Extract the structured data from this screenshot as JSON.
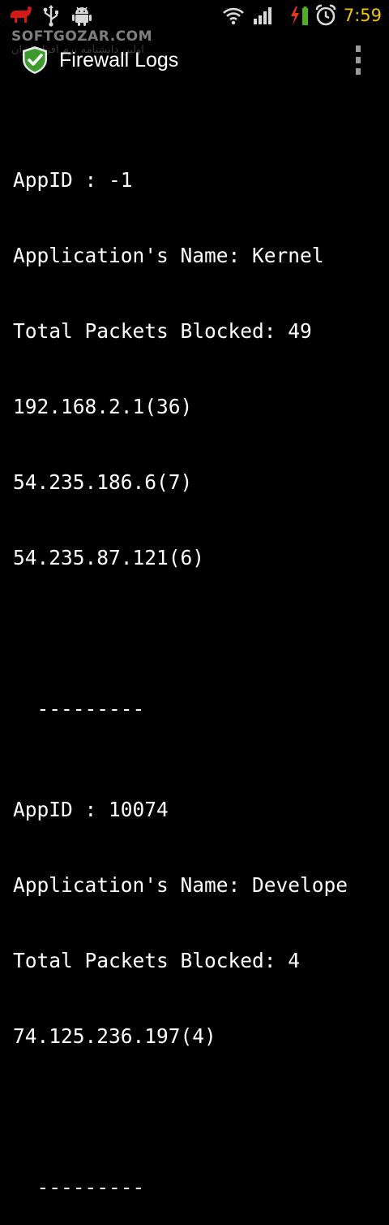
{
  "status_bar": {
    "time": "7:59",
    "icons": [
      "app-notification-icon",
      "usb-icon",
      "android-debug-icon",
      "wifi-icon",
      "signal-icon",
      "battery-charging-icon",
      "alarm-clock-icon"
    ]
  },
  "watermark": {
    "text": "SOFTGOZAR.COM",
    "subtext": "اولین دانشنامه نرم افزار ایران"
  },
  "action_bar": {
    "title": "Firewall Logs",
    "icon": "shield-check-icon",
    "overflow_icon": "overflow-menu-icon"
  },
  "logs": [
    {
      "app_id_line": "AppID : -1",
      "name_line": "Application's Name: Kernel",
      "blocked_line": "Total Packets Blocked: 49",
      "ips": [
        "192.168.2.1(36)",
        "54.235.186.6(7)",
        "54.235.87.121(6)"
      ],
      "separator": "  ---------"
    },
    {
      "app_id_line": "AppID : 10074",
      "name_line": "Application's Name: Develope",
      "blocked_line": "Total Packets Blocked: 4",
      "ips": [
        "74.125.236.197(4)"
      ],
      "separator": "  ---------"
    }
  ],
  "colors": {
    "background": "#000000",
    "text": "#ffffff",
    "clock": "#f3c400",
    "shield": "#3f9a2e",
    "battery": "#4caf25",
    "charge_bolt": "#e53a1a"
  }
}
